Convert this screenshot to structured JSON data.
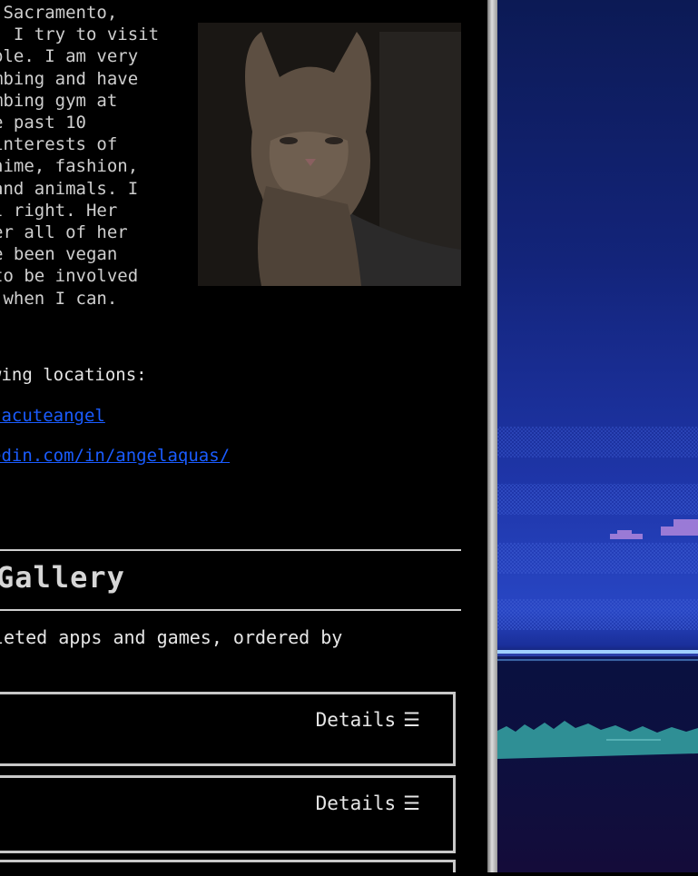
{
  "bio": {
    "lines": [
      " Sacramento,",
      ". I try to visit",
      "ple. I am very",
      "mbing and have",
      "mbing gym at",
      "e past 10",
      "interests of",
      "nime, fashion,",
      "and animals. I",
      "l right. Her",
      "er all of her",
      "e been vegan",
      "to be involved",
      " when I can."
    ]
  },
  "links": {
    "intro": "wing locations:",
    "items": [
      {
        "text": "/acuteangel"
      },
      {
        "text": "edin.com/in/angelaquas/"
      }
    ]
  },
  "gallery": {
    "title": "Gallery",
    "description": "leted apps and games, ordered by",
    "cards": [
      {
        "details_label": "Details",
        "icon": "☰"
      },
      {
        "details_label": "Details",
        "icon": "☰"
      }
    ]
  },
  "colors": {
    "link": "#1a5cff",
    "card_border": "#c8c8c8",
    "cloud": "#9a7ad6",
    "hills": "#2f8f95"
  }
}
